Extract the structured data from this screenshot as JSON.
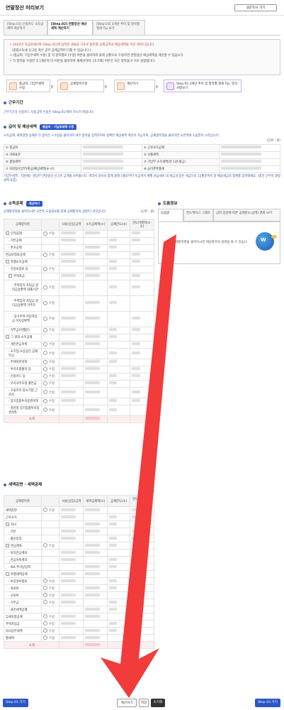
{
  "header": {
    "title": "연말정산 미리보기",
    "survey_button": "설문조사 가기"
  },
  "tabs": [
    {
      "label": "[Step.01] 신용카드 소득공제액 계산하기",
      "active": false
    },
    {
      "label": "[Step.02] 연말정산 예상세액 계산하기",
      "active": true
    },
    {
      "label": "[Step.03] 3개년 추이 및 항목별 절세 Tip 보기",
      "active": false
    }
  ],
  "notice": [
    {
      "text": "2022년 지급명세서와 (Step.01)에 입력한 내용을 기초로 항목별 공제금액과 예상세액을 미리 세워드립니다.",
      "highlight": true
    },
    {
      "text": "(종합소득세 신고용 최신 공무 공제금액이 다를 수 있습니다.)",
      "highlight": false
    },
    {
      "text": "(총급여, 기납부세액 수정) 및 각 항목별로 [수정] 버튼을 클릭하여 올해 상황으로 수정하면 연말정산 예상세액을 계산할 수 있습니다.",
      "highlight": false
    },
    {
      "text": "각 항목을 수정한 후 [계산하기] 버튼을 클릭하여 재계산하며, [초기화] 버튼은 모든 항목을 0 으로 설정합니다.",
      "highlight": false
    }
  ],
  "steps": [
    {
      "label": "총급여, 기납부세액 수정"
    },
    {
      "label": "공제항목수정"
    },
    {
      "label": "계산하기"
    },
    {
      "label": "Step.03 3개년 추이 및 항목별 절세 Tip, 유의사항보기"
    }
  ],
  "work_period": {
    "title": "근무기간",
    "note": "근무기간과 신용카드 사용금액 수정은 (Step.01)에서 하시기 바랍니다."
  },
  "salary": {
    "title": "급여 및 예상세액",
    "badge": "총급여 · 기납부세액 수정",
    "note": "소득공제, 세액감면·공제의 각 항목은 +수정을 클릭하여 세부 항목을 입력하여야 정확한 예상세액 계산이 가능하며, 공제항목명을 클릭하면 오른쪽에 도움말이 나타납니다.",
    "unit": "(단위 : 원)",
    "rows": [
      [
        "① 총급여",
        "② 근로소득공제"
      ],
      [
        "③ 과세표준",
        "⑤ 산출세액"
      ],
      [
        "⑥ 결정세액",
        "⑦ 기납부 소득세액(현 1원 세금)"
      ],
      [
        "⑦ 차감징수납부(환급)예상세액(⑥-⑦)",
        "⑧ 농어촌특별세"
      ]
    ],
    "footnote": "기납부세액 : 직원에는 원납부 연말정산 신고한 금액을 보여줍니다. 따라서 회사로 통해 올해 1월로부터 지급까지 매월 원급세서 내 세금과 달은 세금으로 12월분까지 달 예상세금의 합계를 입력해세요. (총인 근무지 결정세액 표통)"
  },
  "income_deduction": {
    "title": "소득공제",
    "badge": "계산하기",
    "note": "공제항목명을 클릭하시면 오른쪽 도움정보를 통해 공제항목의 설명이 나타납니다.",
    "unit": "(단위 : 원)",
    "headers": [
      "공제항목명",
      "",
      "사용(납입)금액",
      "소득공제액(①)",
      "공제한도(②)",
      "한도이월액(①-②)"
    ],
    "rows": [
      {
        "label": "인적공제",
        "toggle": "-",
        "edit": "수정",
        "level": 0
      },
      {
        "label": "기본공제",
        "toggle": "",
        "edit": "",
        "level": 1
      },
      {
        "label": "추가공제",
        "toggle": "",
        "edit": "",
        "level": 1
      },
      {
        "label": "연금보험료공제",
        "toggle": "",
        "edit": "수정",
        "level": 0
      },
      {
        "label": "특별소득공제",
        "toggle": "-",
        "edit": "",
        "level": 0
      },
      {
        "label": "건강보험료 등",
        "toggle": "",
        "edit": "수정",
        "level": 1
      },
      {
        "label": "주택자금",
        "toggle": "-",
        "edit": "",
        "level": 1
      },
      {
        "label": "주택임차 차입금 원리금상환액 대출기관",
        "toggle": "",
        "edit": "수정",
        "level": 2
      },
      {
        "label": "주택임차 차입금 원리금상환액 거주자",
        "toggle": "",
        "edit": "수정",
        "level": 2
      },
      {
        "label": "장기주택 저당차입금 이자상환액",
        "toggle": "",
        "edit": "수정",
        "level": 2
      },
      {
        "label": "기부금(이월분)",
        "toggle": "",
        "edit": "수정",
        "level": 1
      },
      {
        "label": "그 밖의 소득공제",
        "toggle": "-",
        "edit": "",
        "level": 0
      },
      {
        "label": "개인연금저축",
        "toggle": "",
        "edit": "수정",
        "level": 1
      },
      {
        "label": "소기업·소상공인 공제부금",
        "toggle": "",
        "edit": "수정",
        "level": 1
      },
      {
        "label": "주택마련저축",
        "toggle": "",
        "edit": "수정",
        "level": 1
      },
      {
        "label": "투자조합출자 등",
        "toggle": "",
        "edit": "수정",
        "level": 1
      },
      {
        "label": "신용카드 등",
        "toggle": "",
        "edit": "수정",
        "level": 1
      },
      {
        "label": "우리사주조합 출연금",
        "toggle": "",
        "edit": "수정",
        "level": 1
      },
      {
        "label": "고용유지 중소기업 근로자",
        "toggle": "",
        "edit": "수정",
        "level": 1
      },
      {
        "label": "장기집합투자증권저축",
        "toggle": "",
        "edit": "수정",
        "level": 1
      },
      {
        "label": "청년형 장기집합투자증권저축",
        "toggle": "",
        "edit": "수정",
        "level": 1
      }
    ],
    "subtotal": "소계"
  },
  "tax_credit": {
    "title": "세액감면 · 세액공제",
    "unit": "(단위 : 원)",
    "headers": [
      "공제항목명",
      "",
      "사용(납입)금액",
      "세액공제액(①)",
      "공제한도(②)",
      "한도이월액(①-②)"
    ],
    "rows": [
      {
        "label": "세액감면",
        "toggle": "",
        "edit": "수정",
        "level": 0
      },
      {
        "label": "근로소득",
        "toggle": "",
        "edit": "",
        "level": 0
      },
      {
        "label": "자녀",
        "toggle": "-",
        "edit": "",
        "level": 0
      },
      {
        "label": "기본",
        "toggle": "",
        "edit": "",
        "level": 1
      },
      {
        "label": "출산입양",
        "toggle": "",
        "edit": "",
        "level": 1
      },
      {
        "label": "연금계좌",
        "toggle": "-",
        "edit": "수정",
        "level": 0
      },
      {
        "label": "퇴직연금계좌",
        "toggle": "",
        "edit": "",
        "level": 1
      },
      {
        "label": "연금저축계좌",
        "toggle": "",
        "edit": "",
        "level": 1
      },
      {
        "label": "ISA 추가납입액",
        "toggle": "",
        "edit": "",
        "level": 1
      },
      {
        "label": "특별세액공제",
        "toggle": "-",
        "edit": "",
        "level": 0
      },
      {
        "label": "보장성보험료",
        "toggle": "",
        "edit": "수정",
        "level": 1
      },
      {
        "label": "의료비",
        "toggle": "",
        "edit": "수정",
        "level": 1
      },
      {
        "label": "교육비",
        "toggle": "",
        "edit": "수정",
        "level": 1
      },
      {
        "label": "기부금",
        "toggle": "",
        "edit": "수정",
        "level": 1
      },
      {
        "label": "표준세액공제",
        "toggle": "",
        "edit": "",
        "level": 1
      },
      {
        "label": "납세조합공제",
        "toggle": "",
        "edit": "수정",
        "level": 0
      },
      {
        "label": "주택차입금",
        "toggle": "",
        "edit": "수정",
        "level": 0
      },
      {
        "label": "외국납부세액",
        "toggle": "",
        "edit": "수정",
        "level": 0
      },
      {
        "label": "월세액",
        "toggle": "",
        "edit": "수정",
        "level": 0
      }
    ],
    "subtotal": "소계"
  },
  "help": {
    "title": "도움정보",
    "tabs": [
      "도움말",
      "한도액이고 그래프",
      "급여 종감에 따른 공제한도(금액) 변화 보기"
    ],
    "body": "왼쪽 공제항목명을 클릭하시면 해당항목의 설명을 볼 수 있습니다."
  },
  "footer": {
    "prev_button": "Step 01 가기",
    "calc_button": "계산하기",
    "save_button": "저장",
    "reset_button": "초기화",
    "next_button": "Step 03 가기"
  },
  "colors": {
    "accent_blue": "#2a56c6",
    "arrow_red": "#f23b3b",
    "subtotal_bg": "#fdeef0"
  }
}
